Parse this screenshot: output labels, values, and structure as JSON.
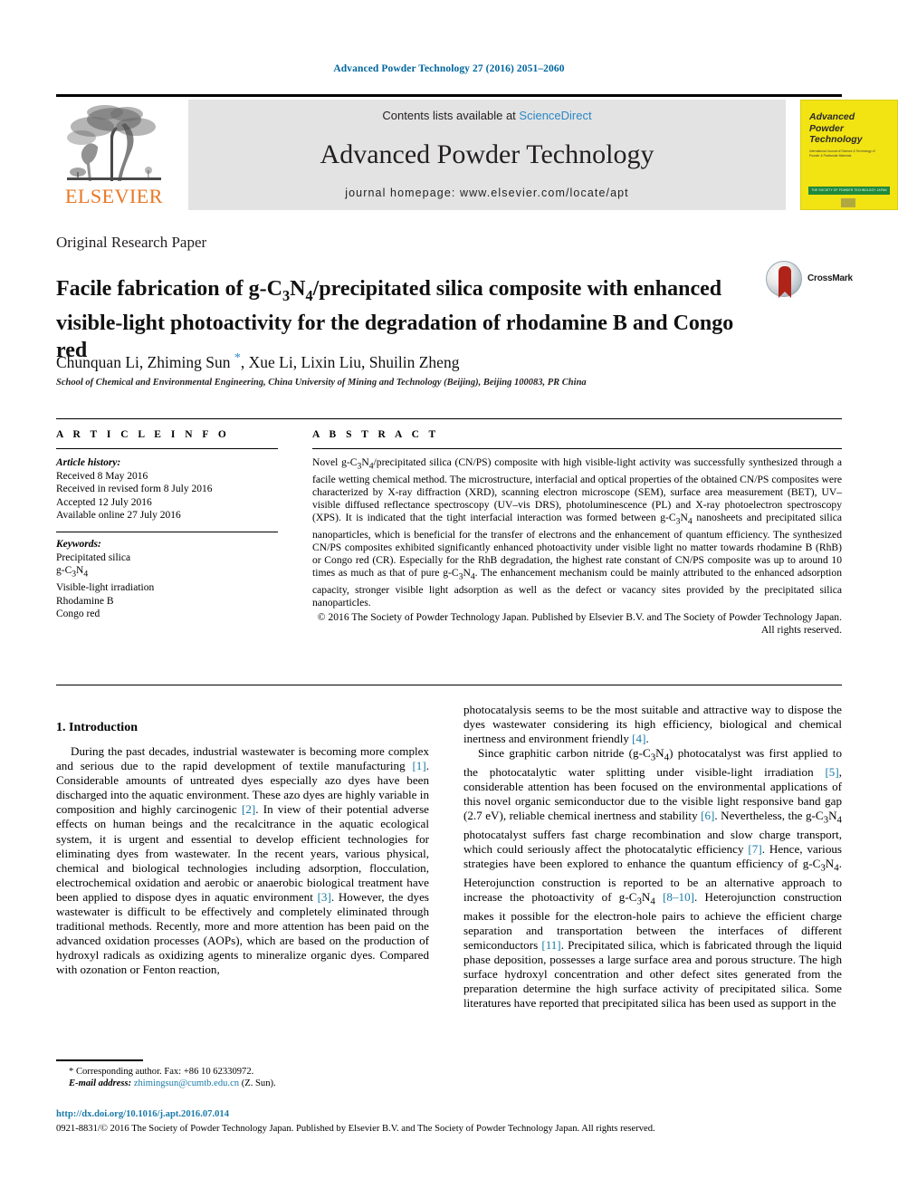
{
  "running_head": "Advanced Powder Technology 27 (2016) 2051–2060",
  "masthead": {
    "contents_prefix": "Contents lists available at ",
    "sciencedirect": "ScienceDirect",
    "journal_title": "Advanced Powder Technology",
    "homepage": "journal homepage: www.elsevier.com/locate/apt",
    "publisher_logo": "ELSEVIER",
    "cover": {
      "title_line1": "Advanced",
      "title_line2": "Powder",
      "title_line3": "Technology",
      "subtitle": "International Journal of Science & Technology of Powder & Particulate Materials",
      "band_text": "THE SOCIETY OF POWDER TECHNOLOGY JAPAN"
    }
  },
  "crossmark": {
    "label": "CrossMark"
  },
  "article": {
    "type": "Original Research Paper",
    "title_html": "Facile fabrication of g-C<sub>3</sub>N<sub>4</sub>/precipitated silica composite with enhanced visible-light photoactivity for the degradation of rhodamine B and Congo red",
    "authors_html": "Chunquan Li, Zhiming Sun <span class=\"star\">*</span>, Xue Li, Lixin Liu, Shuilin Zheng",
    "affiliation": "School of Chemical and Environmental Engineering, China University of Mining and Technology (Beijing), Beijing 100083, PR China"
  },
  "info": {
    "heading": "A R T I C L E   I N F O",
    "history_label": "Article history:",
    "history": [
      "Received 8 May 2016",
      "Received in revised form 8 July 2016",
      "Accepted 12 July 2016",
      "Available online 27 July 2016"
    ],
    "keywords_label": "Keywords:",
    "keywords_html": [
      "Precipitated silica",
      "g-C<sub>3</sub>N<sub>4</sub>",
      "Visible-light irradiation",
      "Rhodamine B",
      "Congo red"
    ]
  },
  "abstract": {
    "heading": "A B S T R A C T",
    "body_html": "Novel g-C<sub>3</sub>N<sub>4</sub>/precipitated silica (CN/PS) composite with high visible-light activity was successfully synthesized through a facile wetting chemical method. The microstructure, interfacial and optical properties of the obtained CN/PS composites were characterized by X-ray diffraction (XRD), scanning electron microscope (SEM), surface area measurement (BET), UV–visible diffused reflectance spectroscopy (UV–vis DRS), photoluminescence (PL) and X-ray photoelectron spectroscopy (XPS). It is indicated that the tight interfacial interaction was formed between g-C<sub>3</sub>N<sub>4</sub> nanosheets and precipitated silica nanoparticles, which is beneficial for the transfer of electrons and the enhancement of quantum efficiency. The synthesized CN/PS composites exhibited significantly enhanced photoactivity under visible light no matter towards rhodamine B (RhB) or Congo red (CR). Especially for the RhB degradation, the highest rate constant of CN/PS composite was up to around 10 times as much as that of pure g-C<sub>3</sub>N<sub>4</sub>. The enhancement mechanism could be mainly attributed to the enhanced adsorption capacity, stronger visible light adsorption as well as the defect or vacancy sites provided by the precipitated silica nanoparticles.",
    "copyright_html": "© 2016 The Society of Powder Technology Japan. Published by Elsevier B.V. and The Society of Powder Technology Japan. All rights reserved."
  },
  "body": {
    "section1_heading": "1. Introduction",
    "left_paragraph1_html": "During the past decades, industrial wastewater is becoming more complex and serious due to the rapid development of textile manufacturing <span class=\"ref\">[1]</span>. Considerable amounts of untreated dyes especially azo dyes have been discharged into the aquatic environment. These azo dyes are highly variable in composition and highly carcinogenic <span class=\"ref\">[2]</span>. In view of their potential adverse effects on human beings and the recalcitrance in the aquatic ecological system, it is urgent and essential to develop efficient technologies for eliminating dyes from wastewater. In the recent years, various physical, chemical and biological technologies including adsorption, flocculation, electrochemical oxidation and aerobic or anaerobic biological treatment have been applied to dispose dyes in aquatic environment <span class=\"ref\">[3]</span>. However, the dyes wastewater is difficult to be effectively and completely eliminated through traditional methods. Recently, more and more attention has been paid on the advanced oxidation processes (AOPs), which are based on the production of hydroxyl radicals as oxidizing agents to mineralize organic dyes. Compared with ozonation or Fenton reaction,",
    "right_paragraph1_html": "photocatalysis seems to be the most suitable and attractive way to dispose the dyes wastewater considering its high efficiency, biological and chemical inertness and environment friendly <span class=\"ref\">[4]</span>.",
    "right_paragraph2_html": "Since graphitic carbon nitride (g-C<sub>3</sub>N<sub>4</sub>) photocatalyst was first applied to the photocatalytic water splitting under visible-light irradiation <span class=\"ref\">[5]</span>, considerable attention has been focused on the environmental applications of this novel organic semiconductor due to the visible light responsive band gap (2.7 eV), reliable chemical inertness and stability <span class=\"ref\">[6]</span>. Nevertheless, the g-C<sub>3</sub>N<sub>4</sub> photocatalyst suffers fast charge recombination and slow charge transport, which could seriously affect the photocatalytic efficiency <span class=\"ref\">[7]</span>. Hence, various strategies have been explored to enhance the quantum efficiency of g-C<sub>3</sub>N<sub>4</sub>. Heterojunction construction is reported to be an alternative approach to increase the photoactivity of g-C<sub>3</sub>N<sub>4</sub> <span class=\"ref\">[8–10]</span>. Heterojunction construction makes it possible for the electron-hole pairs to achieve the efficient charge separation and transportation between the interfaces of different semiconductors <span class=\"ref\">[11]</span>. Precipitated silica, which is fabricated through the liquid phase deposition, possesses a large surface area and porous structure. The high surface hydroxyl concentration and other defect sites generated from the preparation determine the high surface activity of precipitated silica. Some literatures have reported that precipitated silica has been used as support in the"
  },
  "footnote": {
    "corresponding_html": "* Corresponding author. Fax: +86 10 62330972.",
    "email_label": "E-mail address:",
    "email": "zhimingsun@cumtb.edu.cn",
    "email_suffix": "(Z. Sun)."
  },
  "footer": {
    "doi": "http://dx.doi.org/10.1016/j.apt.2016.07.014",
    "issn_line": "0921-8831/© 2016 The Society of Powder Technology Japan. Published by Elsevier B.V. and The Society of Powder Technology Japan. All rights reserved."
  },
  "colors": {
    "link": "#1a7aa8",
    "running_head": "#00669e",
    "elsevier_orange": "#E87722",
    "cover_yellow": "#f2e313",
    "band_gray": "#e3e3e3"
  }
}
